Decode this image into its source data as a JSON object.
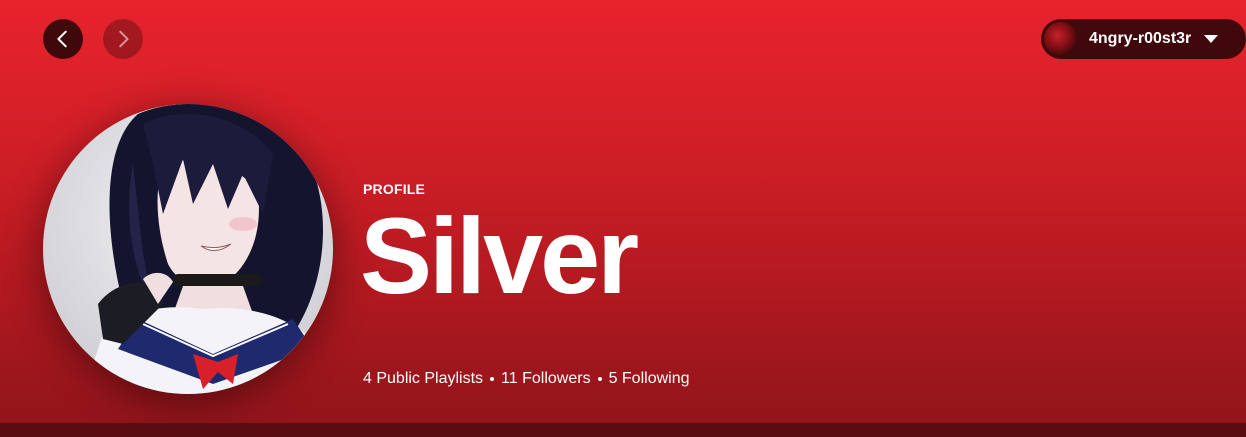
{
  "header": {
    "user_name": "4ngry-r00st3r"
  },
  "profile": {
    "type_label": "PROFILE",
    "name": "Silver",
    "stats": {
      "public_playlists": "4 Public Playlists",
      "followers": "11 Followers",
      "following": "5 Following"
    }
  },
  "colors": {
    "banner_top": "#e8232c",
    "banner_bottom": "#8e141a"
  },
  "icons": {
    "back": "chevron-left-icon",
    "forward": "chevron-right-icon",
    "menu": "chevron-down-icon"
  }
}
